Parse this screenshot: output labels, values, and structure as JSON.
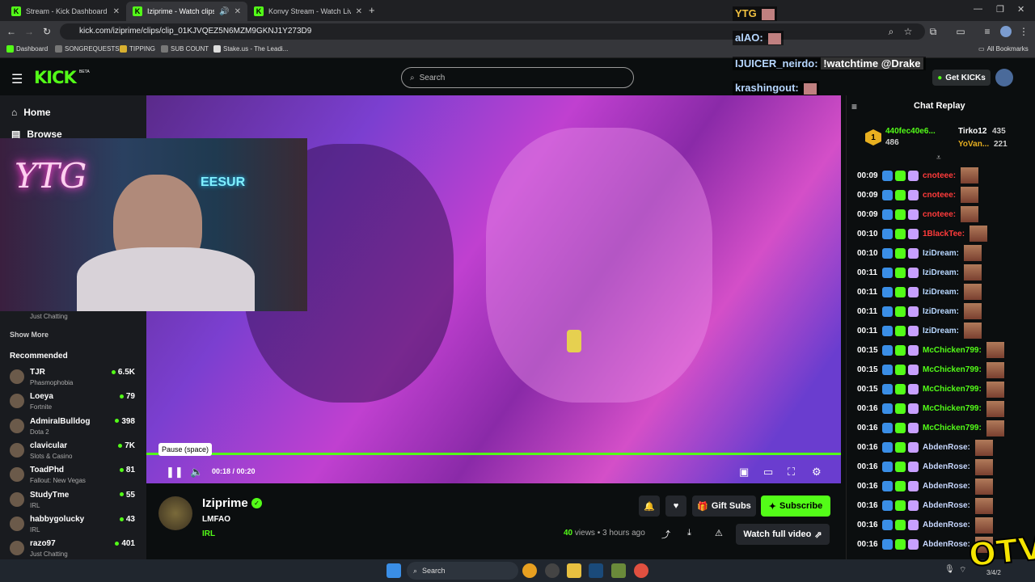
{
  "browser": {
    "tabs": [
      {
        "label": "Stream - Kick Dashboard",
        "active": false
      },
      {
        "label": "Iziprime - Watch clips on K",
        "active": true
      },
      {
        "label": "Konvy Stream - Watch Live on I",
        "active": false
      }
    ],
    "url": "kick.com/iziprime/clips/clip_01KJVQEZ5N6MZM9GKNJ1Y273D9",
    "bookmarks": [
      "Dashboard",
      "SONGREQUESTS",
      "TIPPING",
      "SUB COUNT",
      "Stake.us - The Leadi..."
    ],
    "all_bookmarks": "All Bookmarks"
  },
  "header": {
    "logo": "KICK",
    "beta": "BETA",
    "search_placeholder": "Search",
    "get_kicks": "Get KICKs"
  },
  "sidebar": {
    "nav": [
      {
        "label": "Home",
        "icon": "home-icon"
      },
      {
        "label": "Browse",
        "icon": "browse-icon"
      }
    ],
    "partial_category": "Just Chatting",
    "show_more": "Show More",
    "recommended_title": "Recommended",
    "recommended": [
      {
        "name": "TJR",
        "category": "Phasmophobia",
        "viewers": "6.5K"
      },
      {
        "name": "Loeya",
        "category": "Fortnite",
        "viewers": "79"
      },
      {
        "name": "AdmiralBulldog",
        "category": "Dota 2",
        "viewers": "398"
      },
      {
        "name": "clavicular",
        "category": "Slots & Casino",
        "viewers": "7K"
      },
      {
        "name": "ToadPhd",
        "category": "Fallout: New Vegas",
        "viewers": "81"
      },
      {
        "name": "StudyTme",
        "category": "IRL",
        "viewers": "55"
      },
      {
        "name": "habbygolucky",
        "category": "IRL",
        "viewers": "43"
      },
      {
        "name": "razo97",
        "category": "Just Chatting",
        "viewers": "401"
      }
    ]
  },
  "webcam": {
    "neon_text": "YTG",
    "sign_text": "EESUR"
  },
  "player": {
    "tooltip": "Pause (space)",
    "time_current": "00:18",
    "time_total": "00:20",
    "progress_fraction": 0.9
  },
  "clip": {
    "channel": "Iziprime",
    "title": "LMFAO",
    "category": "IRL",
    "views_count": "40",
    "views_label": "views",
    "age": "3 hours ago",
    "gift_subs": "Gift Subs",
    "subscribe": "Subscribe",
    "watch_full": "Watch full video"
  },
  "overlay_chat": [
    {
      "text": "YTG"
    },
    {
      "text": "alAO:"
    },
    {
      "user": "IJUICER_neirdo:",
      "text": "!watchtime @Drake"
    },
    {
      "text": "krashingout:"
    }
  ],
  "chat": {
    "title": "Chat Replay",
    "leaderboard": [
      {
        "name": "440fec40e6...",
        "value": "486"
      },
      {
        "name": "Tirko12",
        "value": "435"
      },
      {
        "name": "YoVan...",
        "value": "221"
      }
    ],
    "messages": [
      {
        "time": "00:09",
        "user": "cnoteee:",
        "color": "#ff3b3b"
      },
      {
        "time": "00:09",
        "user": "cnoteee:",
        "color": "#ff3b3b"
      },
      {
        "time": "00:09",
        "user": "cnoteee:",
        "color": "#ff3b3b"
      },
      {
        "time": "00:10",
        "user": "1BlackTee:",
        "color": "#ff3b3b"
      },
      {
        "time": "00:10",
        "user": "IziDream:",
        "color": "#b7d7ff"
      },
      {
        "time": "00:11",
        "user": "IziDream:",
        "color": "#b7d7ff"
      },
      {
        "time": "00:11",
        "user": "IziDream:",
        "color": "#b7d7ff"
      },
      {
        "time": "00:11",
        "user": "IziDream:",
        "color": "#b7d7ff"
      },
      {
        "time": "00:11",
        "user": "IziDream:",
        "color": "#b7d7ff"
      },
      {
        "time": "00:15",
        "user": "McChicken799:",
        "color": "#53fc18"
      },
      {
        "time": "00:15",
        "user": "McChicken799:",
        "color": "#53fc18"
      },
      {
        "time": "00:15",
        "user": "McChicken799:",
        "color": "#53fc18"
      },
      {
        "time": "00:16",
        "user": "McChicken799:",
        "color": "#53fc18"
      },
      {
        "time": "00:16",
        "user": "McChicken799:",
        "color": "#53fc18"
      },
      {
        "time": "00:16",
        "user": "AbdenRose:",
        "color": "#c8d8ff"
      },
      {
        "time": "00:16",
        "user": "AbdenRose:",
        "color": "#c8d8ff"
      },
      {
        "time": "00:16",
        "user": "AbdenRose:",
        "color": "#c8d8ff"
      },
      {
        "time": "00:16",
        "user": "AbdenRose:",
        "color": "#c8d8ff"
      },
      {
        "time": "00:16",
        "user": "AbdenRose:",
        "color": "#c8d8ff"
      },
      {
        "time": "00:16",
        "user": "AbdenRose:",
        "color": "#c8d8ff"
      }
    ]
  },
  "taskbar": {
    "search": "Search",
    "date": "3/4/2"
  },
  "watermark": "OTV",
  "colors": {
    "accent": "#53fc18",
    "background": "#0b0e0f",
    "sidebar": "#191b1f"
  }
}
